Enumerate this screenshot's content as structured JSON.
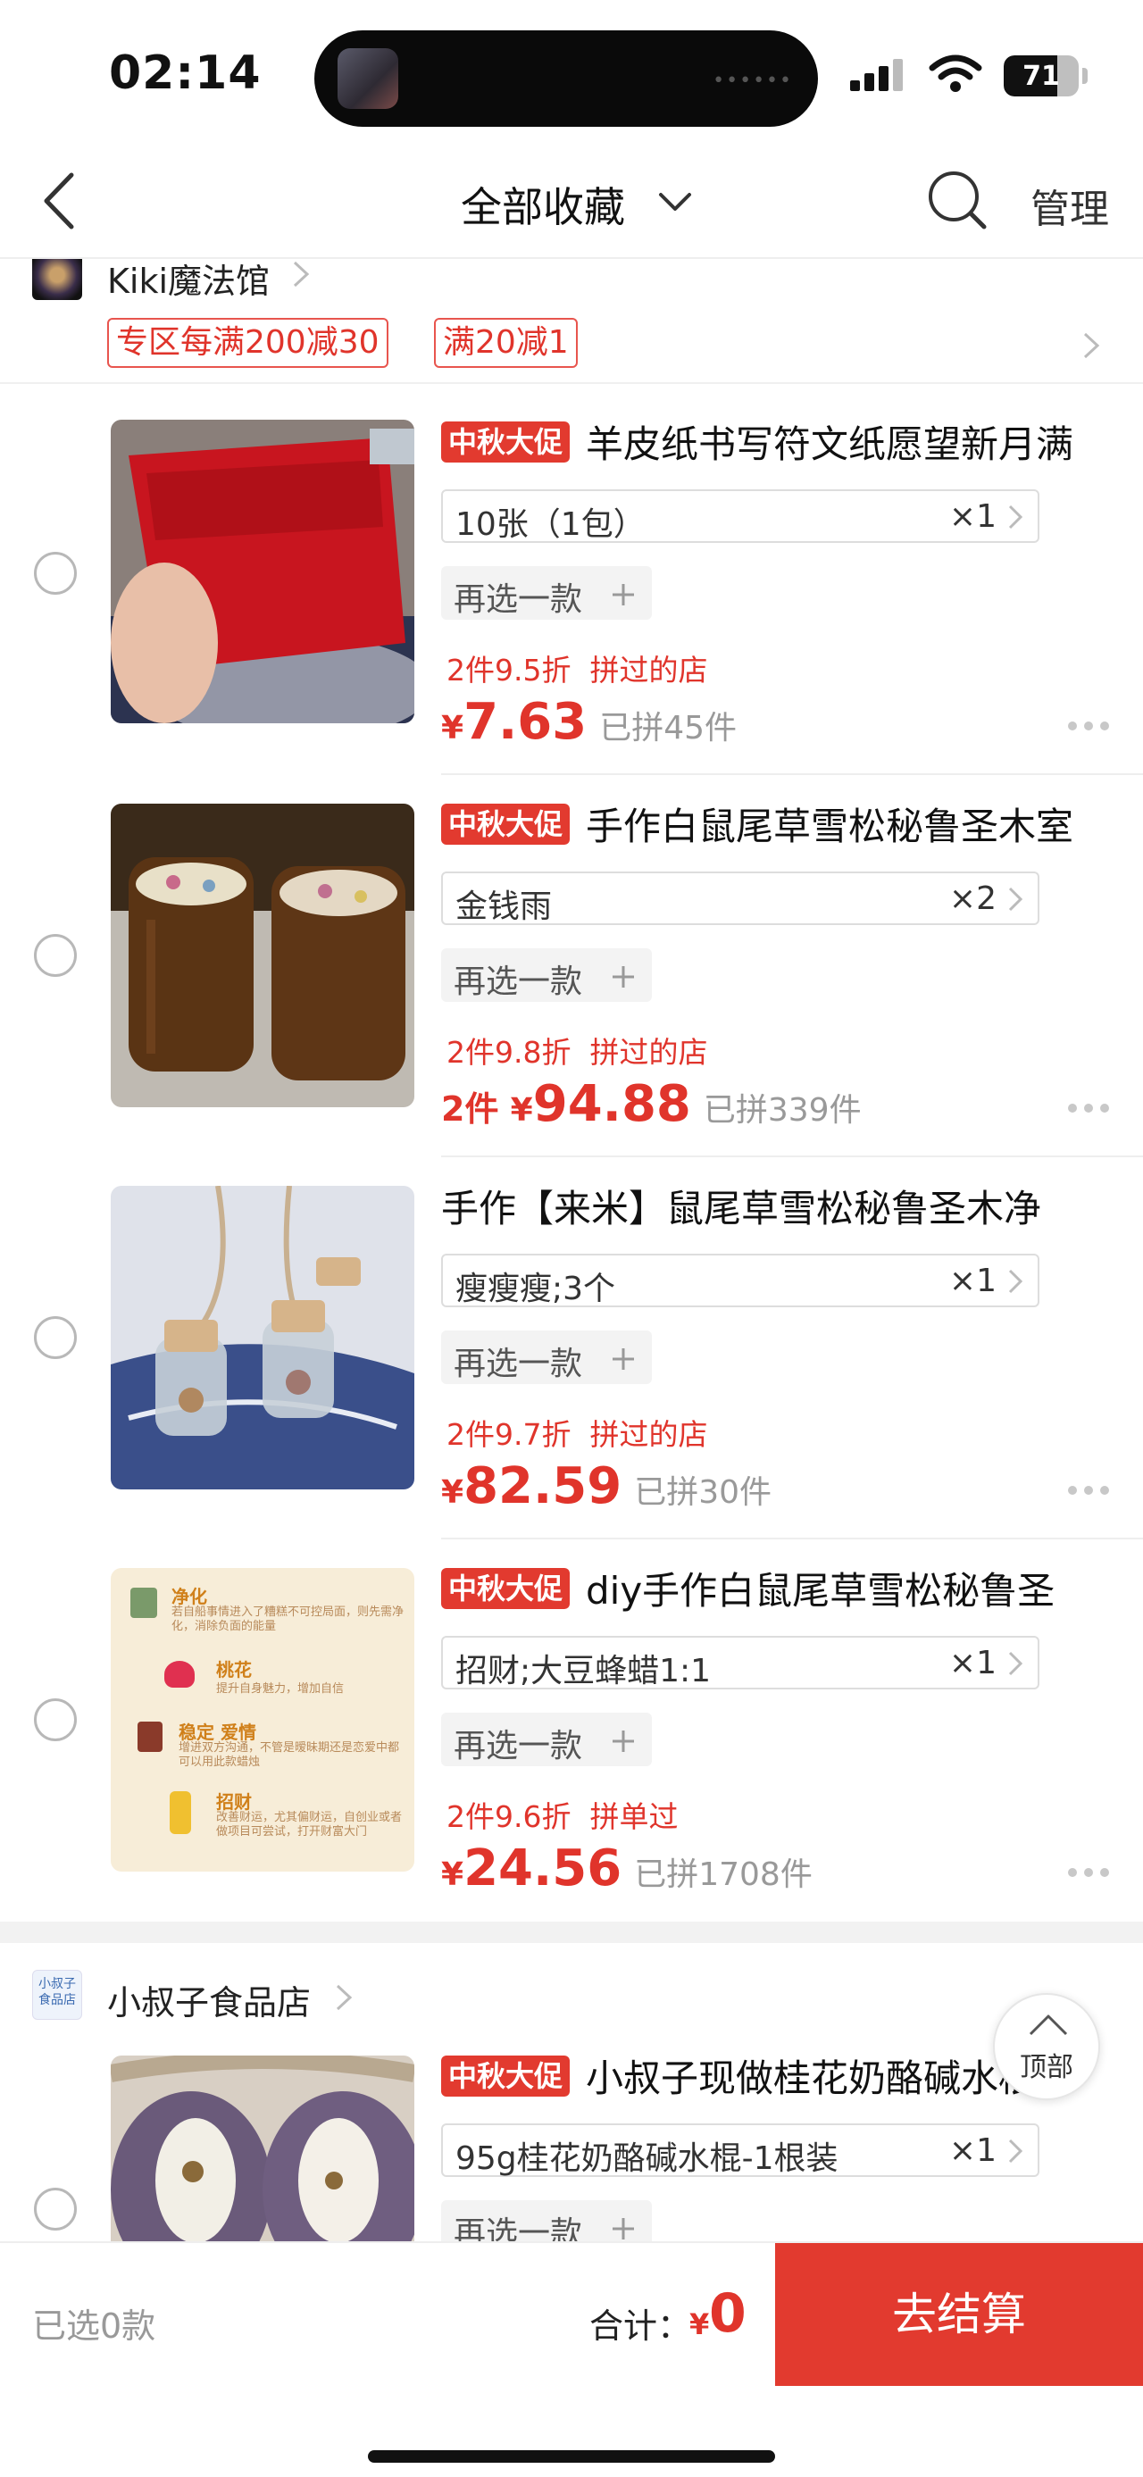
{
  "status_bar": {
    "time": "02:14",
    "battery_level": 71,
    "battery_text": "71"
  },
  "nav": {
    "title": "全部收藏",
    "manage_label": "管理"
  },
  "store1": {
    "name": "Kiki魔法馆",
    "promos": [
      "专区每满200减30",
      "满20减1"
    ]
  },
  "items": [
    {
      "badge": "中秋大促",
      "title": "羊皮纸书写符文纸愿望新月满",
      "sku": "10张（1包）",
      "qty": "×1",
      "reselect": "再选一款",
      "discount": "2件9.5折",
      "discount_extra": "拼过的店",
      "price_prefix": "",
      "yen": "¥",
      "price": "7.63",
      "sold": "已拼45件"
    },
    {
      "badge": "中秋大促",
      "title": "手作白鼠尾草雪松秘鲁圣木室",
      "sku": "金钱雨",
      "qty": "×2",
      "reselect": "再选一款",
      "discount": "2件9.8折",
      "discount_extra": "拼过的店",
      "price_prefix": "2件 ",
      "yen": "¥",
      "price": "94.88",
      "sold": "已拼339件"
    },
    {
      "badge": "",
      "title": "手作【来米】鼠尾草雪松秘鲁圣木净",
      "sku": "瘦瘦瘦;3个",
      "qty": "×1",
      "reselect": "再选一款",
      "discount": "2件9.7折",
      "discount_extra": "拼过的店",
      "price_prefix": "",
      "yen": "¥",
      "price": "82.59",
      "sold": "已拼30件"
    },
    {
      "badge": "中秋大促",
      "title": "diy手作白鼠尾草雪松秘鲁圣",
      "sku": "招财;大豆蜂蜡1:1",
      "qty": "×1",
      "reselect": "再选一款",
      "discount": "2件9.6折",
      "discount_extra": "拼单过",
      "price_prefix": "",
      "yen": "¥",
      "price": "24.56",
      "sold": "已拼1708件"
    },
    {
      "badge": "中秋大促",
      "title": "小叔子现做桂花奶酪碱水棍",
      "sku": "95g桂花奶酪碱水棍-1根装",
      "qty": "×1",
      "reselect": "再选一款"
    }
  ],
  "item4_image_text": {
    "l1": "净化",
    "l1d": "若自船事情进入了糟糕不可控局面，则先需净化，消除负面的能量",
    "l2": "桃花",
    "l2d": "提升自身魅力，增加自信",
    "l3": "稳定 爱情",
    "l3d": "增进双方沟通，不管是暧昧期还是恋爱中都可以用此款蜡烛",
    "l4": "招财",
    "l4d": "改善财运，尤其偏财运，自创业或者做项目可尝试，打开财富大门"
  },
  "store2": {
    "name": "小叔子食品店",
    "logo_text": "小叔子食品店"
  },
  "back_to_top": "顶部",
  "bottom": {
    "selected": "已选0款",
    "total_label": "合计：",
    "yen": "¥",
    "total": "0",
    "checkout": "去结算"
  },
  "colors": {
    "accent": "#e23a2f",
    "text_red": "#e0342b"
  }
}
